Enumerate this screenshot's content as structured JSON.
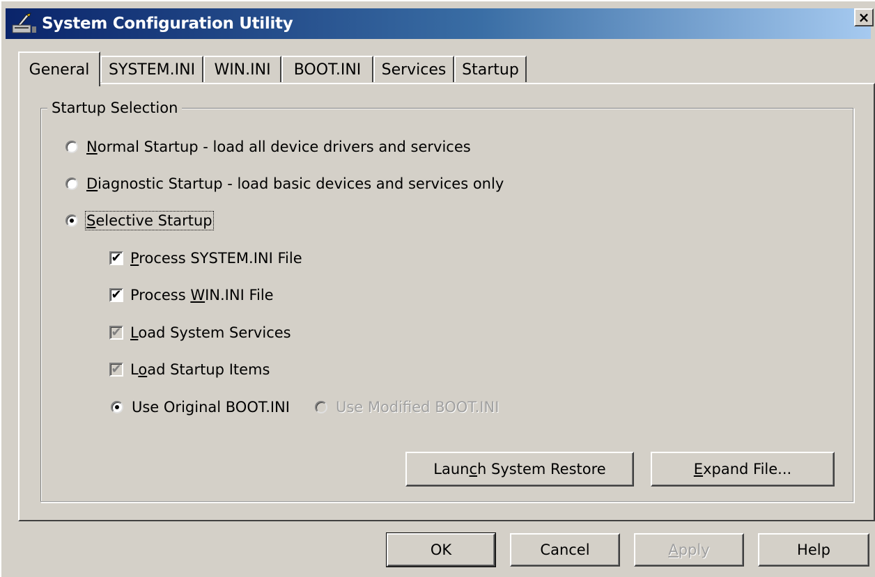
{
  "window": {
    "title": "System Configuration Utility",
    "close_glyph": "×"
  },
  "tabs": [
    {
      "label": "General",
      "active": true
    },
    {
      "label": "SYSTEM.INI"
    },
    {
      "label": "WIN.INI"
    },
    {
      "label": "BOOT.INI"
    },
    {
      "label": "Services"
    },
    {
      "label": "Startup"
    }
  ],
  "startup_selection": {
    "group_label": "Startup Selection",
    "normal": {
      "pre": "",
      "key": "N",
      "post": "ormal Startup - load all device drivers and services",
      "selected": false
    },
    "diagnostic": {
      "pre": "",
      "key": "D",
      "post": "iagnostic Startup - load basic devices and services only",
      "selected": false
    },
    "selective": {
      "pre": "",
      "key": "S",
      "post": "elective Startup",
      "selected": true
    },
    "process_system_ini": {
      "pre": "",
      "key": "P",
      "post": "rocess SYSTEM.INI File",
      "checked": true
    },
    "process_win_ini": {
      "pre": "Process ",
      "key": "W",
      "post": "IN.INI File",
      "checked": true
    },
    "load_system_services": {
      "pre": "",
      "key": "L",
      "post": "oad System Services",
      "checked": true,
      "disabled": true
    },
    "load_startup_items": {
      "pre": "L",
      "key": "o",
      "post": "ad Startup Items",
      "checked": true,
      "disabled": true
    },
    "use_original_boot": {
      "label": "Use Original BOOT.INI",
      "selected": true
    },
    "use_modified_boot": {
      "label": "Use Modified BOOT.INI",
      "selected": false,
      "disabled": true
    }
  },
  "buttons": {
    "launch_restore": {
      "pre": "Laun",
      "key": "c",
      "post": "h System Restore"
    },
    "expand_file": {
      "pre": "",
      "key": "E",
      "post": "xpand File..."
    },
    "ok": "OK",
    "cancel": "Cancel",
    "apply": {
      "pre": "",
      "key": "A",
      "post": "pply"
    },
    "help": "Help"
  },
  "icons": {
    "app": "msconfig-icon",
    "check": "✔"
  }
}
